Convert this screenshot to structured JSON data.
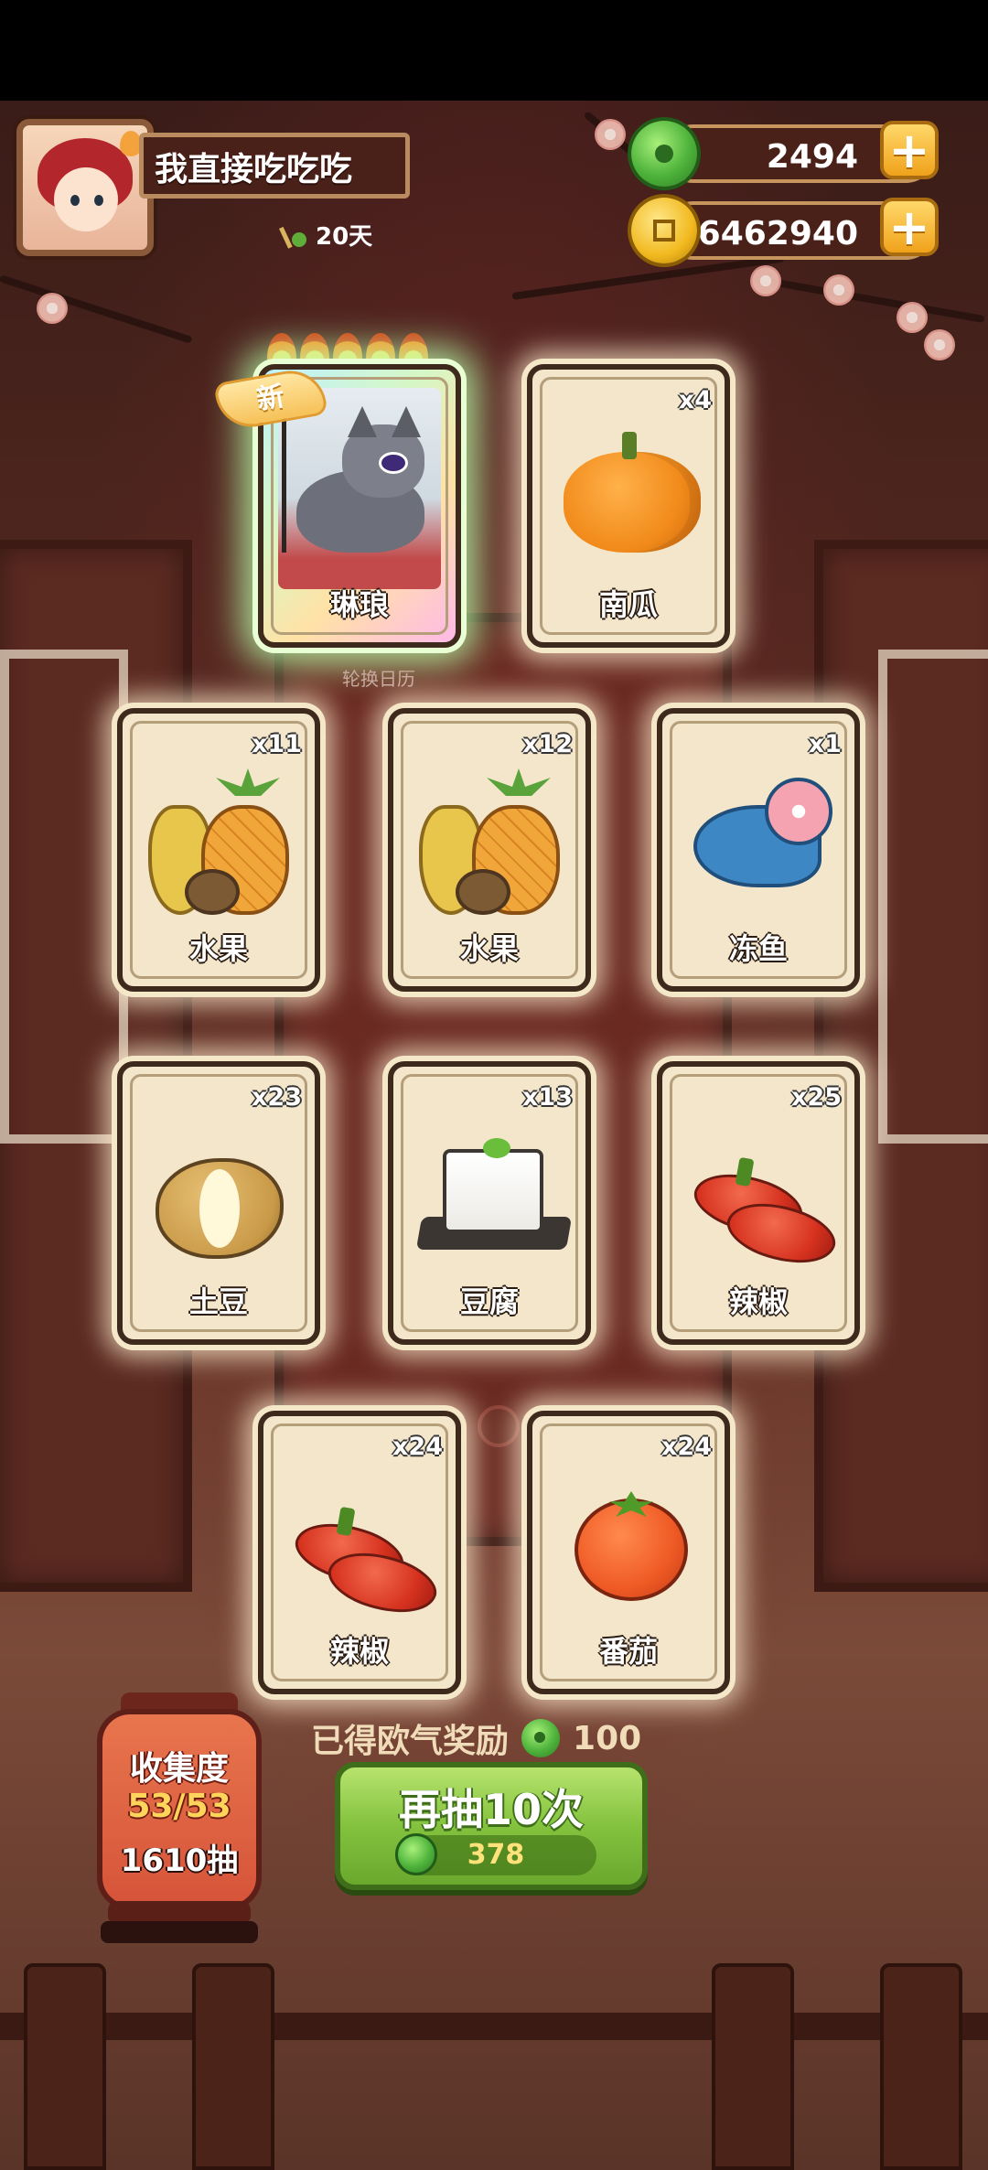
{
  "player": {
    "name": "我直接吃吃吃",
    "days": "20天"
  },
  "currencies": {
    "jade": "2494",
    "coins": "76462940"
  },
  "cards": [
    {
      "label": "琳琅",
      "count": "",
      "rarity": "new",
      "badge": "新"
    },
    {
      "label": "南瓜",
      "count": "x4"
    },
    {
      "label": "水果",
      "count": "x11"
    },
    {
      "label": "水果",
      "count": "x12"
    },
    {
      "label": "冻鱼",
      "count": "x1"
    },
    {
      "label": "土豆",
      "count": "x23"
    },
    {
      "label": "豆腐",
      "count": "x13"
    },
    {
      "label": "辣椒",
      "count": "x25"
    },
    {
      "label": "辣椒",
      "count": "x24"
    },
    {
      "label": "番茄",
      "count": "x24"
    }
  ],
  "under_text": "轮换日历",
  "reward": {
    "label": "已得欧气奖励",
    "amount": "100"
  },
  "draw_button": {
    "label": "再抽10次",
    "cost": "378"
  },
  "collection": {
    "title": "收集度",
    "progress": "53/53",
    "pulls": "1610抽"
  },
  "colors": {
    "accent_green": "#83c23e",
    "card_bg": "#f3e6cb",
    "currency_gold": "#f0a21b"
  }
}
